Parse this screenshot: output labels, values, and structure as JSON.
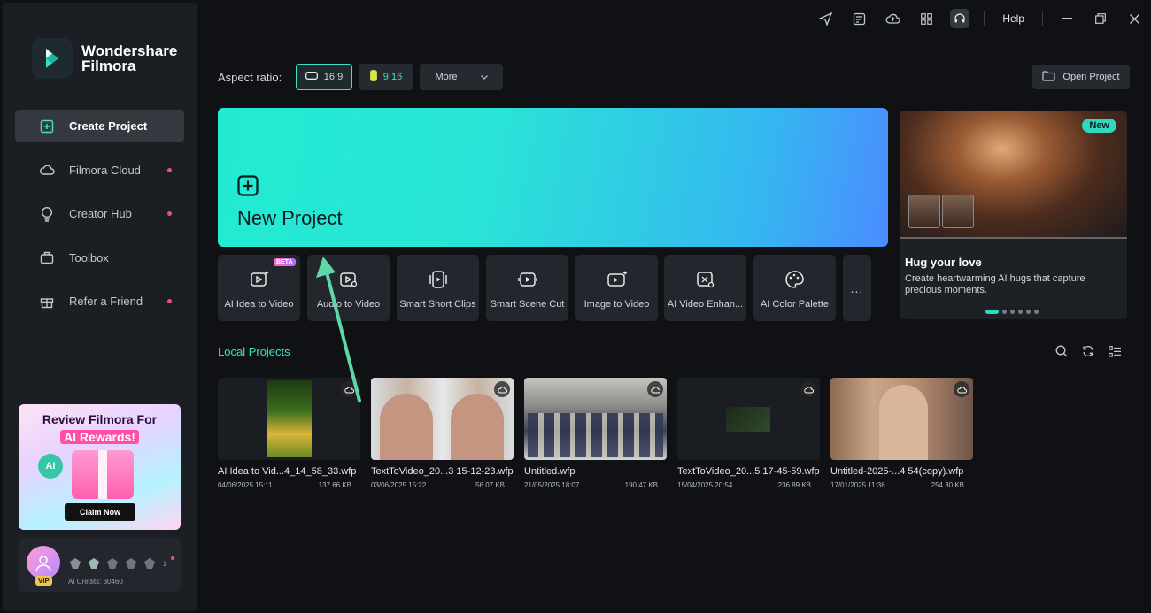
{
  "app": {
    "name_line1": "Wondershare",
    "name_line2": "Filmora"
  },
  "sidebar": {
    "items": [
      {
        "label": "Create Project",
        "active": true,
        "dot": false,
        "icon": "add-square-icon"
      },
      {
        "label": "Filmora Cloud",
        "active": false,
        "dot": true,
        "icon": "cloud-icon"
      },
      {
        "label": "Creator Hub",
        "active": false,
        "dot": true,
        "icon": "lightbulb-icon"
      },
      {
        "label": "Toolbox",
        "active": false,
        "dot": false,
        "icon": "toolbox-icon"
      },
      {
        "label": "Refer a Friend",
        "active": false,
        "dot": true,
        "icon": "gift-icon"
      }
    ],
    "promo": {
      "title_line1": "Review Filmora For",
      "title_line2": "AI Rewards!",
      "ai_badge": "AI",
      "cta": "Claim Now"
    },
    "account": {
      "vip": "VIP",
      "credits": "AI Credits: 30460"
    }
  },
  "topbar": {
    "help": "Help"
  },
  "aspect": {
    "label": "Aspect ratio:",
    "options": [
      {
        "label": "16:9",
        "selected": true
      },
      {
        "label": "9:16",
        "selected": false
      }
    ],
    "more": "More"
  },
  "open_project": "Open Project",
  "new_project": {
    "label": "New Project"
  },
  "featured": {
    "tag": "New",
    "title": "Hug your love",
    "description": "Create heartwarming AI hugs that capture precious moments.",
    "slide_count": 6,
    "active_slide": 1
  },
  "tools": [
    {
      "label": "AI Idea to Video",
      "beta": "BETA"
    },
    {
      "label": "Audio to Video"
    },
    {
      "label": "Smart Short Clips"
    },
    {
      "label": "Smart Scene Cut"
    },
    {
      "label": "Image to Video"
    },
    {
      "label": "AI Video Enhan..."
    },
    {
      "label": "AI Color Palette"
    }
  ],
  "more_tools": "...",
  "local_projects": {
    "title": "Local Projects",
    "items": [
      {
        "name": "AI Idea to Vid...4_14_58_33.wfp",
        "date": "04/06/2025 15:11",
        "size": "137.66 KB"
      },
      {
        "name": "TextToVideo_20...3 15-12-23.wfp",
        "date": "03/06/2025 15:22",
        "size": "56.07 KB"
      },
      {
        "name": "Untitled.wfp",
        "date": "21/05/2025 18:07",
        "size": "190.47 KB"
      },
      {
        "name": "TextToVideo_20...5 17-45-59.wfp",
        "date": "15/04/2025 20:54",
        "size": "236.89 KB"
      },
      {
        "name": "Untitled-2025-...4 54(copy).wfp",
        "date": "17/01/2025 11:36",
        "size": "254.30 KB"
      }
    ]
  }
}
